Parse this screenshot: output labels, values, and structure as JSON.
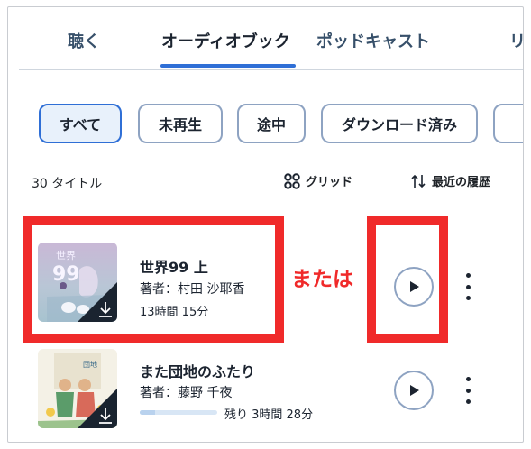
{
  "tabs": [
    {
      "label": "聴く"
    },
    {
      "label": "オーディオブック",
      "active": true
    },
    {
      "label": "ポッドキャスト"
    },
    {
      "label": "リ"
    }
  ],
  "filters": [
    {
      "label": "すべて",
      "selected": true
    },
    {
      "label": "未再生"
    },
    {
      "label": "途中"
    },
    {
      "label": "ダウンロード済み"
    }
  ],
  "list_header": {
    "count": "30 タイトル",
    "grid_label": "グリッド",
    "grid_icon": "grid-icon",
    "sort_label": "最近の履歴",
    "sort_icon": "sort-arrows-icon"
  },
  "books": [
    {
      "title": "世界99 上",
      "author": "著者：村田 沙耶香",
      "duration": "13時間 15分",
      "downloaded": true
    },
    {
      "title": "また団地のふたり",
      "author": "著者：藤野 千夜",
      "remaining": "残り 3時間 28分",
      "progress": 0.2,
      "downloaded": true
    }
  ],
  "annotation": {
    "label": "または",
    "color": "#f02a2a"
  },
  "colors": {
    "accent": "#2f6fd6",
    "chip_border": "#8ea3c2",
    "annotation": "#f02a2a"
  }
}
